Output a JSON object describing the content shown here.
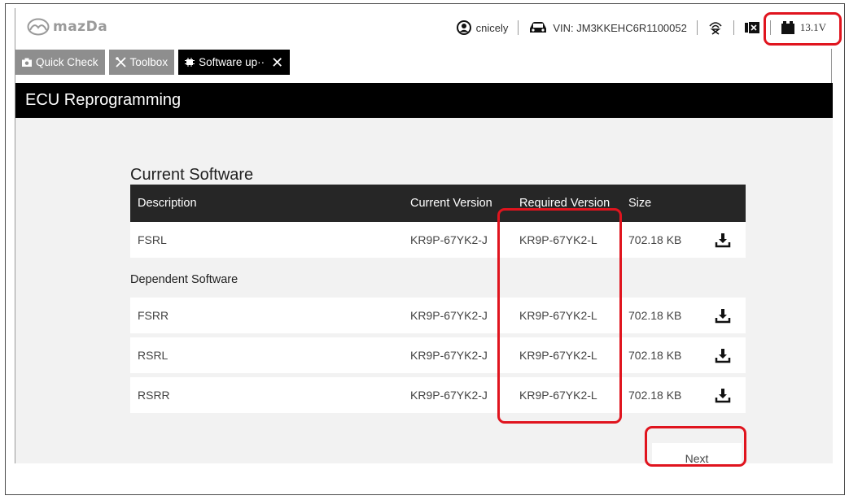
{
  "brand": {
    "logo_text": "mazDa",
    "logo_icon": "mazda-wing-logo"
  },
  "status_bar": {
    "user": "cnicely",
    "vin": "VIN: JM3KKEHC6R1100052",
    "voltage": "13.1V",
    "icons": [
      "user-icon",
      "car-icon",
      "signal-icon",
      "vci-icon",
      "battery-icon"
    ]
  },
  "tabs": [
    {
      "label": "Quick Check",
      "icon": "camera-icon",
      "active": false
    },
    {
      "label": "Toolbox",
      "icon": "tools-icon",
      "active": false
    },
    {
      "label": "Software up··",
      "icon": "ecu-chip-icon",
      "active": true
    }
  ],
  "page_title": "ECU Reprogramming",
  "current_software": {
    "title": "Current Software",
    "columns": [
      "Description",
      "Current Version",
      "Required Version",
      "Size"
    ],
    "rows": [
      {
        "description": "FSRL",
        "current": "KR9P-67YK2-J",
        "required": "KR9P-67YK2-L",
        "size": "702.18 KB"
      }
    ]
  },
  "dependent_software": {
    "title": "Dependent Software",
    "rows": [
      {
        "description": "FSRR",
        "current": "KR9P-67YK2-J",
        "required": "KR9P-67YK2-L",
        "size": "702.18 KB"
      },
      {
        "description": "RSRL",
        "current": "KR9P-67YK2-J",
        "required": "KR9P-67YK2-L",
        "size": "702.18 KB"
      },
      {
        "description": "RSRR",
        "current": "KR9P-67YK2-J",
        "required": "KR9P-67YK2-L",
        "size": "702.18 KB"
      }
    ]
  },
  "next_label": "Next",
  "colors": {
    "annotation": "#e0141e",
    "header_bg": "#000000",
    "tab_inactive": "#8e8e8e",
    "content_bg": "#f2f2f2"
  }
}
